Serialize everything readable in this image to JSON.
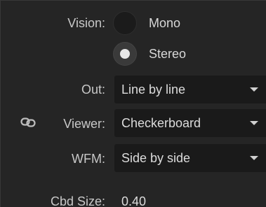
{
  "vision": {
    "label": "Vision:",
    "options": [
      {
        "label": "Mono",
        "selected": false
      },
      {
        "label": "Stereo",
        "selected": true
      }
    ]
  },
  "out": {
    "label": "Out:",
    "value": "Line by line"
  },
  "viewer": {
    "label": "Viewer:",
    "value": "Checkerboard",
    "link_icon": "link-icon"
  },
  "wfm": {
    "label": "WFM:",
    "value": "Side by side"
  },
  "cbd_size": {
    "label": "Cbd Size:",
    "value": "0.40"
  },
  "colors": {
    "panel_bg": "#252525",
    "outer_bg": "#121212",
    "dropdown_bg": "#1a1a1a",
    "text": "#d9d9d9"
  }
}
